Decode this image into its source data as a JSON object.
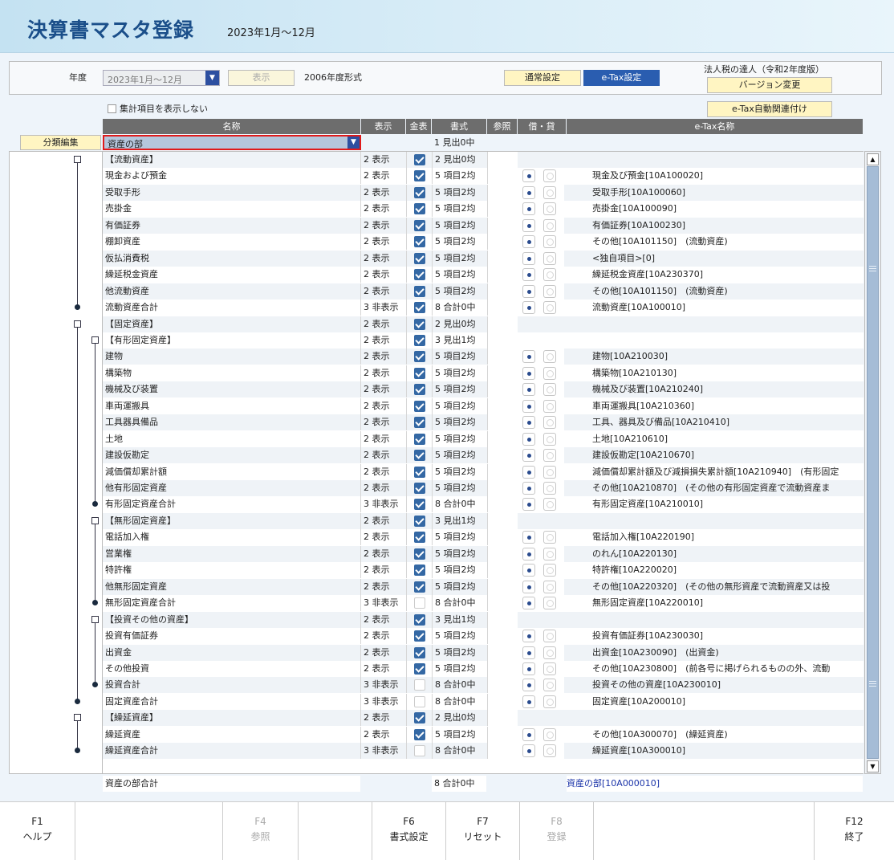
{
  "header": {
    "title": "決算書マスタ登録",
    "subtitle": "2023年1月～12月"
  },
  "toolbar": {
    "year_label": "年度",
    "year_value": "2023年1月～12月",
    "show_button": "表示",
    "format_label": "2006年度形式",
    "normal_setting": "通常設定",
    "etax_setting": "e-Tax設定",
    "product_label": "法人税の達人（令和2年度版）",
    "version_change": "バージョン変更",
    "etax_auto_link": "e-Tax自動関連付け",
    "hide_sum_items": "集計項目を表示しない",
    "category_edit": "分類編集"
  },
  "columns": {
    "name": "名称",
    "display": "表示",
    "kinhyo": "金表",
    "format": "書式",
    "ref": "参照",
    "drcr": "借・貸",
    "etax": "e-Tax名称"
  },
  "selected": {
    "name": "資産の部",
    "format": "1 見出0中"
  },
  "rows": [
    {
      "name": "【流動資産】",
      "disp": "2 表示",
      "chk": true,
      "fmt": "2 見出0均",
      "radio": false,
      "etax": ""
    },
    {
      "name": "現金および預金",
      "disp": "2 表示",
      "chk": true,
      "fmt": "5 項目2均",
      "radio": true,
      "etax": "現金及び預金[10A100020]"
    },
    {
      "name": "受取手形",
      "disp": "2 表示",
      "chk": true,
      "fmt": "5 項目2均",
      "radio": true,
      "etax": "受取手形[10A100060]"
    },
    {
      "name": "売掛金",
      "disp": "2 表示",
      "chk": true,
      "fmt": "5 項目2均",
      "radio": true,
      "etax": "売掛金[10A100090]"
    },
    {
      "name": "有価証券",
      "disp": "2 表示",
      "chk": true,
      "fmt": "5 項目2均",
      "radio": true,
      "etax": "有価証券[10A100230]"
    },
    {
      "name": "棚卸資産",
      "disp": "2 表示",
      "chk": true,
      "fmt": "5 項目2均",
      "radio": true,
      "etax": "その他[10A101150]　(流動資産)"
    },
    {
      "name": "仮払消費税",
      "disp": "2 表示",
      "chk": true,
      "fmt": "5 項目2均",
      "radio": true,
      "etax": "<独自項目>[0]"
    },
    {
      "name": "繰延税金資産",
      "disp": "2 表示",
      "chk": true,
      "fmt": "5 項目2均",
      "radio": true,
      "etax": "繰延税金資産[10A230370]"
    },
    {
      "name": "他流動資産",
      "disp": "2 表示",
      "chk": true,
      "fmt": "5 項目2均",
      "radio": true,
      "etax": "その他[10A101150]　(流動資産)"
    },
    {
      "name": "流動資産合計",
      "disp": "3 非表示",
      "chk": true,
      "fmt": "8 合計0中",
      "radio": true,
      "etax": "流動資産[10A100010]"
    },
    {
      "name": "【固定資産】",
      "disp": "2 表示",
      "chk": true,
      "fmt": "2 見出0均",
      "radio": false,
      "etax": ""
    },
    {
      "name": "【有形固定資産】",
      "disp": "2 表示",
      "chk": true,
      "fmt": "3 見出1均",
      "radio": false,
      "etax": ""
    },
    {
      "name": "建物",
      "disp": "2 表示",
      "chk": true,
      "fmt": "5 項目2均",
      "radio": true,
      "etax": "建物[10A210030]"
    },
    {
      "name": "構築物",
      "disp": "2 表示",
      "chk": true,
      "fmt": "5 項目2均",
      "radio": true,
      "etax": "構築物[10A210130]"
    },
    {
      "name": "機械及び装置",
      "disp": "2 表示",
      "chk": true,
      "fmt": "5 項目2均",
      "radio": true,
      "etax": "機械及び装置[10A210240]"
    },
    {
      "name": "車両運搬具",
      "disp": "2 表示",
      "chk": true,
      "fmt": "5 項目2均",
      "radio": true,
      "etax": "車両運搬具[10A210360]"
    },
    {
      "name": "工具器具備品",
      "disp": "2 表示",
      "chk": true,
      "fmt": "5 項目2均",
      "radio": true,
      "etax": "工具、器具及び備品[10A210410]"
    },
    {
      "name": "土地",
      "disp": "2 表示",
      "chk": true,
      "fmt": "5 項目2均",
      "radio": true,
      "etax": "土地[10A210610]"
    },
    {
      "name": "建設仮勘定",
      "disp": "2 表示",
      "chk": true,
      "fmt": "5 項目2均",
      "radio": true,
      "etax": "建設仮勘定[10A210670]"
    },
    {
      "name": "減価償却累計額",
      "disp": "2 表示",
      "chk": true,
      "fmt": "5 項目2均",
      "radio": true,
      "etax": "減価償却累計額及び減損損失累計額[10A210940]　(有形固定"
    },
    {
      "name": "他有形固定資産",
      "disp": "2 表示",
      "chk": true,
      "fmt": "5 項目2均",
      "radio": true,
      "etax": "その他[10A210870]　(その他の有形固定資産で流動資産ま"
    },
    {
      "name": "有形固定資産合計",
      "disp": "3 非表示",
      "chk": true,
      "fmt": "8 合計0中",
      "radio": true,
      "etax": "有形固定資産[10A210010]"
    },
    {
      "name": "【無形固定資産】",
      "disp": "2 表示",
      "chk": true,
      "fmt": "3 見出1均",
      "radio": false,
      "etax": ""
    },
    {
      "name": "電話加入権",
      "disp": "2 表示",
      "chk": true,
      "fmt": "5 項目2均",
      "radio": true,
      "etax": "電話加入権[10A220190]"
    },
    {
      "name": "営業権",
      "disp": "2 表示",
      "chk": true,
      "fmt": "5 項目2均",
      "radio": true,
      "etax": "のれん[10A220130]"
    },
    {
      "name": "特許権",
      "disp": "2 表示",
      "chk": true,
      "fmt": "5 項目2均",
      "radio": true,
      "etax": "特許権[10A220020]"
    },
    {
      "name": "他無形固定資産",
      "disp": "2 表示",
      "chk": true,
      "fmt": "5 項目2均",
      "radio": true,
      "etax": "その他[10A220320]　(その他の無形資産で流動資産又は投"
    },
    {
      "name": "無形固定資産合計",
      "disp": "3 非表示",
      "chk": false,
      "fmt": "8 合計0中",
      "radio": true,
      "etax": "無形固定資産[10A220010]"
    },
    {
      "name": "【投資その他の資産】",
      "disp": "2 表示",
      "chk": true,
      "fmt": "3 見出1均",
      "radio": false,
      "etax": ""
    },
    {
      "name": "投資有価証券",
      "disp": "2 表示",
      "chk": true,
      "fmt": "5 項目2均",
      "radio": true,
      "etax": "投資有価証券[10A230030]"
    },
    {
      "name": "出資金",
      "disp": "2 表示",
      "chk": true,
      "fmt": "5 項目2均",
      "radio": true,
      "etax": "出資金[10A230090]　(出資金)"
    },
    {
      "name": "その他投資",
      "disp": "2 表示",
      "chk": true,
      "fmt": "5 項目2均",
      "radio": true,
      "etax": "その他[10A230800]　(前各号に掲げられるものの外、流動"
    },
    {
      "name": "投資合計",
      "disp": "3 非表示",
      "chk": false,
      "fmt": "8 合計0中",
      "radio": true,
      "etax": "投資その他の資産[10A230010]"
    },
    {
      "name": "固定資産合計",
      "disp": "3 非表示",
      "chk": false,
      "fmt": "8 合計0中",
      "radio": true,
      "etax": "固定資産[10A200010]"
    },
    {
      "name": "【繰延資産】",
      "disp": "2 表示",
      "chk": true,
      "fmt": "2 見出0均",
      "radio": false,
      "etax": ""
    },
    {
      "name": "繰延資産",
      "disp": "2 表示",
      "chk": true,
      "fmt": "5 項目2均",
      "radio": true,
      "etax": "その他[10A300070]　(繰延資産)"
    },
    {
      "name": "繰延資産合計",
      "disp": "3 非表示",
      "chk": false,
      "fmt": "8 合計0中",
      "radio": true,
      "etax": "繰延資産[10A300010]"
    }
  ],
  "footer_row": {
    "name": "資産の部合計",
    "fmt": "8 合計0中",
    "etax": "資産の部[10A000010]"
  },
  "fkeys": [
    {
      "key": "F1",
      "label": "ヘルプ",
      "enabled": true
    },
    {
      "key": "",
      "label": "",
      "enabled": true
    },
    {
      "key": "F4",
      "label": "参照",
      "enabled": false
    },
    {
      "key": "",
      "label": "",
      "enabled": true
    },
    {
      "key": "F6",
      "label": "書式設定",
      "enabled": true
    },
    {
      "key": "F7",
      "label": "リセット",
      "enabled": true
    },
    {
      "key": "F8",
      "label": "登録",
      "enabled": false
    },
    {
      "key": "",
      "label": "",
      "enabled": true
    },
    {
      "key": "F12",
      "label": "終了",
      "enabled": true
    }
  ],
  "colors": {
    "accent": "#2a5db0",
    "title": "#1b4f8a",
    "selection_border": "#e01a1a",
    "checkbox": "#3468a4"
  }
}
